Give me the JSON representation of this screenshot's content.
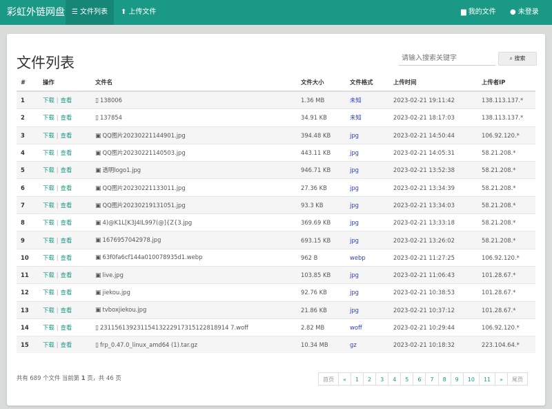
{
  "nav": {
    "brand": "彩虹外链网盘",
    "items": [
      {
        "label": "文件列表",
        "icon": "list-icon",
        "glyph": "☰"
      },
      {
        "label": "上传文件",
        "icon": "upload-icon",
        "glyph": "⬆"
      }
    ],
    "right": [
      {
        "label": "我的文件",
        "icon": "folder-icon",
        "glyph": "▆"
      },
      {
        "label": "未登录",
        "icon": "user-icon",
        "glyph": "●"
      }
    ]
  },
  "main": {
    "title": "文件列表",
    "search": {
      "placeholder": "请输入搜索关键字",
      "button": "搜索"
    },
    "table": {
      "headers": [
        "#",
        "操作",
        "文件名",
        "文件大小",
        "文件格式",
        "上传时间",
        "上传者IP"
      ],
      "actions": {
        "download": "下载",
        "view": "查看",
        "sep": "|"
      },
      "rows": [
        {
          "n": "1",
          "name": "138006",
          "type": "file",
          "size": "1.36 MB",
          "fmt": "未知",
          "time": "2023-02-21 19:11:42",
          "ip": "138.113.137.*"
        },
        {
          "n": "2",
          "name": "137854",
          "type": "file",
          "size": "34.91 KB",
          "fmt": "未知",
          "time": "2023-02-21 18:17:03",
          "ip": "138.113.137.*"
        },
        {
          "n": "3",
          "name": "QQ图片20230221144901.jpg",
          "type": "image",
          "size": "394.48 KB",
          "fmt": "jpg",
          "time": "2023-02-21 14:50:44",
          "ip": "106.92.120.*"
        },
        {
          "n": "4",
          "name": "QQ图片20230221140503.jpg",
          "type": "image",
          "size": "443.11 KB",
          "fmt": "jpg",
          "time": "2023-02-21 14:05:31",
          "ip": "58.21.208.*"
        },
        {
          "n": "5",
          "name": "透明logo1.jpg",
          "type": "image",
          "size": "946.71 KB",
          "fmt": "jpg",
          "time": "2023-02-21 13:52:38",
          "ip": "58.21.208.*"
        },
        {
          "n": "6",
          "name": "QQ图片20230221133011.jpg",
          "type": "image",
          "size": "27.36 KB",
          "fmt": "jpg",
          "time": "2023-02-21 13:34:39",
          "ip": "58.21.208.*"
        },
        {
          "n": "7",
          "name": "QQ图片20230219131051.jpg",
          "type": "image",
          "size": "93.3 KB",
          "fmt": "jpg",
          "time": "2023-02-21 13:34:03",
          "ip": "58.21.208.*"
        },
        {
          "n": "8",
          "name": "4)@K1L[K3J4IL997(@]{Z{3.jpg",
          "type": "image",
          "size": "369.69 KB",
          "fmt": "jpg",
          "time": "2023-02-21 13:33:18",
          "ip": "58.21.208.*"
        },
        {
          "n": "9",
          "name": "1676957042978.jpg",
          "type": "image",
          "size": "693.15 KB",
          "fmt": "jpg",
          "time": "2023-02-21 13:26:02",
          "ip": "58.21.208.*"
        },
        {
          "n": "10",
          "name": "63f0fa6cf144a010078935d1.webp",
          "type": "image",
          "size": "962 B",
          "fmt": "webp",
          "time": "2023-02-21 11:27:25",
          "ip": "106.92.120.*"
        },
        {
          "n": "11",
          "name": "live.jpg",
          "type": "image",
          "size": "103.85 KB",
          "fmt": "jpg",
          "time": "2023-02-21 11:06:43",
          "ip": "101.28.67.*"
        },
        {
          "n": "12",
          "name": "jiekou.jpg",
          "type": "image",
          "size": "92.76 KB",
          "fmt": "jpg",
          "time": "2023-02-21 10:38:53",
          "ip": "101.28.67.*"
        },
        {
          "n": "13",
          "name": "tvboxjiekou.jpg",
          "type": "image",
          "size": "21.86 KB",
          "fmt": "jpg",
          "time": "2023-02-21 10:37:12",
          "ip": "101.28.67.*"
        },
        {
          "n": "14",
          "name": "23115613923115413222917315122818914 7.woff",
          "type": "file",
          "size": "2.82 MB",
          "fmt": "woff",
          "time": "2023-02-21 10:29:44",
          "ip": "106.92.120.*"
        },
        {
          "n": "15",
          "name": "frp_0.47.0_linux_amd64 (1).tar.gz",
          "type": "file",
          "size": "10.34 MB",
          "fmt": "gz",
          "time": "2023-02-21 10:18:32",
          "ip": "223.104.64.*"
        }
      ]
    },
    "footer": {
      "total_prefix": "共有",
      "total": "689",
      "total_suffix": "个文件 当前第",
      "page": "1",
      "page_suffix": "页，共",
      "pages": "46",
      "pages_suffix": "页"
    },
    "pagination": [
      "首页",
      "«",
      "1",
      "2",
      "3",
      "4",
      "5",
      "6",
      "7",
      "8",
      "9",
      "10",
      "11",
      "»",
      "尾页"
    ]
  }
}
